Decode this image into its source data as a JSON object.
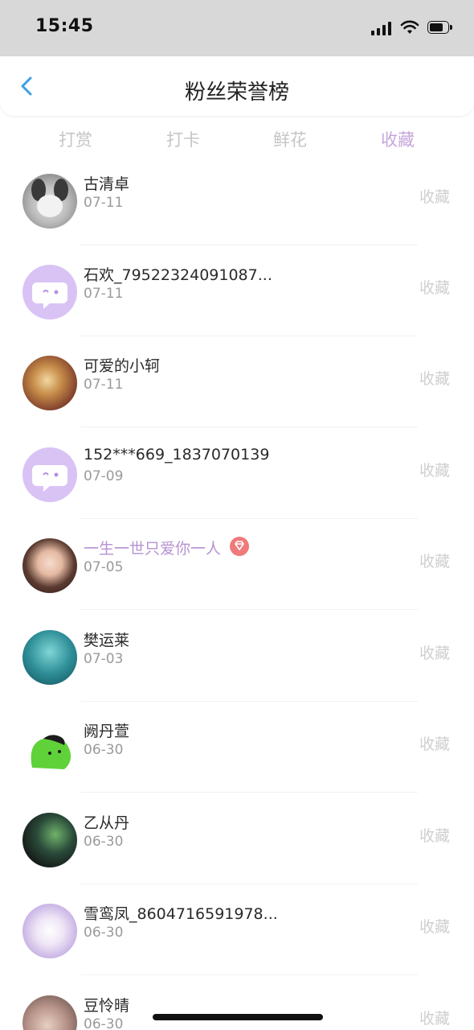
{
  "status_bar": {
    "time": "15:45"
  },
  "header": {
    "title": "粉丝荣誉榜"
  },
  "tabs": [
    {
      "label": "打赏",
      "active": false
    },
    {
      "label": "打卡",
      "active": false
    },
    {
      "label": "鲜花",
      "active": false
    },
    {
      "label": "收藏",
      "active": true
    }
  ],
  "rows": [
    {
      "name": "古清卓",
      "date": "07-11",
      "action": "收藏"
    },
    {
      "name": "石欢_79522324091087...",
      "date": "07-11",
      "action": "收藏"
    },
    {
      "name": "可爱的小轲",
      "date": "07-11",
      "action": "收藏"
    },
    {
      "name": "152***669_1837070139",
      "date": "07-09",
      "action": "收藏"
    },
    {
      "name": "一生一世只爱你一人",
      "date": "07-05",
      "action": "收藏"
    },
    {
      "name": "樊运莱",
      "date": "07-03",
      "action": "收藏"
    },
    {
      "name": "阙丹萱",
      "date": "06-30",
      "action": "收藏"
    },
    {
      "name": "乙从丹",
      "date": "06-30",
      "action": "收藏"
    },
    {
      "name": "雪鸾凤_8604716591978...",
      "date": "06-30",
      "action": "收藏"
    },
    {
      "name": "豆怜晴",
      "date": "06-30",
      "action": "收藏"
    }
  ],
  "colors": {
    "accent": "#c6a6db",
    "vip_badge": "#f07a7a",
    "back_arrow": "#3aa0e6"
  }
}
